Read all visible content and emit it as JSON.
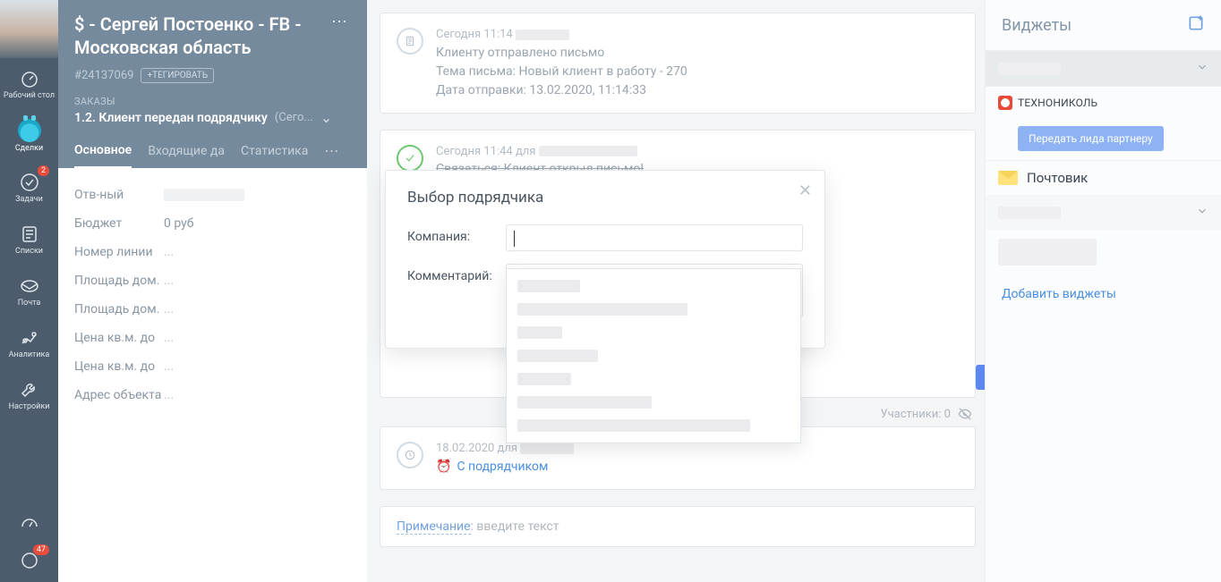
{
  "rail": {
    "items": [
      {
        "label": "Рабочий стол",
        "name": "dashboard"
      },
      {
        "label": "Сделки",
        "name": "deals",
        "active": true
      },
      {
        "label": "Задачи",
        "name": "tasks",
        "badge": "2"
      },
      {
        "label": "Списки",
        "name": "lists"
      },
      {
        "label": "Почта",
        "name": "mail"
      },
      {
        "label": "Аналитика",
        "name": "analytics"
      },
      {
        "label": "Настройки",
        "name": "settings"
      }
    ],
    "chat_badge": "47"
  },
  "deal": {
    "title": "$ - Сергей Постоенко - FB - Московская область",
    "id": "#24137069",
    "tag_btn": "+ТЕГИРОВАТЬ",
    "orders_label": "ЗАКАЗЫ",
    "stage": "1.2. Клиент передан подрядчику",
    "stage_date": "(Сего...",
    "tabs": [
      "Основное",
      "Входящие да",
      "Статистика"
    ],
    "fields": [
      {
        "label": "Отв-ный",
        "value": ""
      },
      {
        "label": "Бюджет",
        "value": "0",
        "suffix": "руб"
      },
      {
        "label": "Номер линии",
        "value": "..."
      },
      {
        "label": "Площадь дом.",
        "value": "..."
      },
      {
        "label": "Площадь дом.",
        "value": "..."
      },
      {
        "label": "Цена кв.м. до",
        "value": "..."
      },
      {
        "label": "Цена кв.м. до",
        "value": "..."
      },
      {
        "label": "Адрес объекта",
        "value": "..."
      }
    ]
  },
  "timeline": {
    "email": {
      "time": "Сегодня 11:14",
      "line1": "Клиенту отправлено письмо",
      "line2": "Тема письма: Новый клиент в работу - 270",
      "line3": "Дата отправки: 13.02.2020, 11:14:33"
    },
    "done": {
      "time": "Сегодня 11:44  для",
      "text": "Связаться: Клиент открыл письмо!"
    },
    "task": {
      "time": "18.02.2020 для",
      "text": "С подрядчиком"
    },
    "participants": "Участники: 0",
    "note_label": "Примечание",
    "note_placeholder": ": введите текст"
  },
  "modal": {
    "title": "Выбор подрядчика",
    "company_label": "Компания:",
    "comment_label": "Комментарий:"
  },
  "widgets": {
    "title": "Виджеты",
    "tn_label": "ТЕХНОНИКОЛЬ",
    "tn_btn": "Передать лида партнеру",
    "mail_label": "Почтовик",
    "add_link": "Добавить виджеты"
  }
}
